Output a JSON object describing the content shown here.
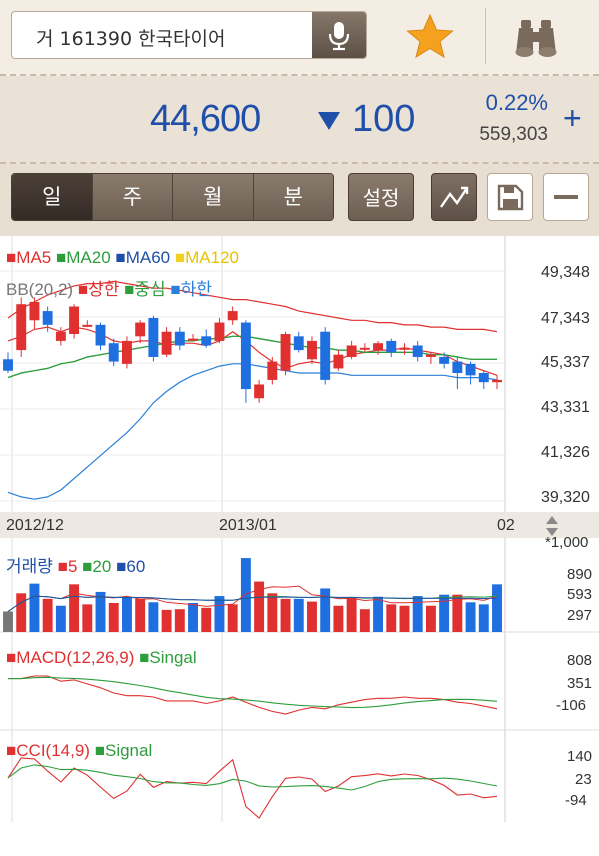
{
  "search": {
    "text": "거 161390 한국타이어"
  },
  "icons": {
    "mic": "microphone-icon",
    "favorite": "star-icon",
    "explore": "binoculars-icon",
    "colors": {
      "star": "#f4a11f",
      "up": "#e03030",
      "down": "#1f4fa8"
    }
  },
  "quote": {
    "price": "44,600",
    "change": "100",
    "rate": "0.22%",
    "volume": "559,303",
    "plus": "+"
  },
  "toolbar": {
    "periods": [
      "일",
      "주",
      "월",
      "분"
    ],
    "active_index": 0,
    "settings": "설정"
  },
  "price_chart": {
    "legend_ma": [
      {
        "label": "MA5",
        "color": "#e03030"
      },
      {
        "label": "MA20",
        "color": "#2e9e3c"
      },
      {
        "label": "MA60",
        "color": "#1f4fa8"
      },
      {
        "label": "MA120",
        "color": "#f0d020"
      }
    ],
    "legend_bb": {
      "title": "BB(20,2)",
      "items": [
        {
          "label": "상한",
          "color": "#e03030"
        },
        {
          "label": "중심",
          "color": "#2e9e3c"
        },
        {
          "label": "하한",
          "color": "#2a7fd8"
        }
      ]
    },
    "y_labels": [
      "49,348",
      "47,343",
      "45,337",
      "43,331",
      "41,326",
      "39,320"
    ]
  },
  "date_axis": {
    "labels": [
      "2012/12",
      "2013/01",
      "02"
    ]
  },
  "volume_chart": {
    "legend": {
      "title": "거래량",
      "items": [
        {
          "label": "5",
          "color": "#e03030"
        },
        {
          "label": "20",
          "color": "#2e9e3c"
        },
        {
          "label": "60",
          "color": "#1f4fa8"
        }
      ]
    },
    "unit": "*1,000",
    "y_labels": [
      "890",
      "593",
      "297"
    ]
  },
  "macd_chart": {
    "legend": [
      {
        "label": "MACD(12,26,9)",
        "color": "#e03030"
      },
      {
        "label": "Singal",
        "color": "#2e9e3c"
      }
    ],
    "y_labels": [
      "808",
      "351",
      "-106"
    ]
  },
  "cci_chart": {
    "legend": [
      {
        "label": "CCI(14,9)",
        "color": "#e03030"
      },
      {
        "label": "Signal",
        "color": "#2e9e3c"
      }
    ],
    "y_labels": [
      "140",
      "23",
      "-94"
    ]
  },
  "chart_data": {
    "type": "candlestick",
    "title": "",
    "x": [
      "2012/12",
      "2013/01",
      "02"
    ],
    "ylim": [
      39320,
      49348
    ],
    "candles": [
      {
        "o": 45500,
        "c": 45000,
        "h": 45800,
        "l": 44900
      },
      {
        "o": 45900,
        "c": 47900,
        "h": 48200,
        "l": 45600
      },
      {
        "o": 47200,
        "c": 48000,
        "h": 48200,
        "l": 46800
      },
      {
        "o": 47600,
        "c": 47000,
        "h": 47800,
        "l": 46700
      },
      {
        "o": 46300,
        "c": 46700,
        "h": 46900,
        "l": 46100
      },
      {
        "o": 46600,
        "c": 47800,
        "h": 47900,
        "l": 46400
      },
      {
        "o": 47000,
        "c": 47000,
        "h": 47200,
        "l": 46900
      },
      {
        "o": 47000,
        "c": 46100,
        "h": 47100,
        "l": 45900
      },
      {
        "o": 46200,
        "c": 45400,
        "h": 46400,
        "l": 45200
      },
      {
        "o": 45300,
        "c": 46300,
        "h": 46500,
        "l": 45100
      },
      {
        "o": 46500,
        "c": 47100,
        "h": 47200,
        "l": 46200
      },
      {
        "o": 47300,
        "c": 45600,
        "h": 47400,
        "l": 45400
      },
      {
        "o": 45700,
        "c": 46700,
        "h": 46900,
        "l": 45600
      },
      {
        "o": 46700,
        "c": 46100,
        "h": 46900,
        "l": 45900
      },
      {
        "o": 46400,
        "c": 46400,
        "h": 46600,
        "l": 46300
      },
      {
        "o": 46500,
        "c": 46100,
        "h": 46800,
        "l": 46000
      },
      {
        "o": 46300,
        "c": 47100,
        "h": 47300,
        "l": 46200
      },
      {
        "o": 47200,
        "c": 47600,
        "h": 47800,
        "l": 47000
      },
      {
        "o": 47100,
        "c": 44200,
        "h": 47200,
        "l": 43600
      },
      {
        "o": 43800,
        "c": 44400,
        "h": 44600,
        "l": 43600
      },
      {
        "o": 44600,
        "c": 45400,
        "h": 45600,
        "l": 44400
      },
      {
        "o": 45000,
        "c": 46600,
        "h": 46700,
        "l": 44800
      },
      {
        "o": 46500,
        "c": 45900,
        "h": 46700,
        "l": 45800
      },
      {
        "o": 45500,
        "c": 46300,
        "h": 46500,
        "l": 45300
      },
      {
        "o": 46700,
        "c": 44600,
        "h": 46900,
        "l": 44400
      },
      {
        "o": 45100,
        "c": 45700,
        "h": 45900,
        "l": 45000
      },
      {
        "o": 45600,
        "c": 46100,
        "h": 46300,
        "l": 45500
      },
      {
        "o": 46000,
        "c": 46000,
        "h": 46200,
        "l": 45800
      },
      {
        "o": 45900,
        "c": 46200,
        "h": 46300,
        "l": 45700
      },
      {
        "o": 46300,
        "c": 45800,
        "h": 46400,
        "l": 45600
      },
      {
        "o": 46000,
        "c": 46000,
        "h": 46200,
        "l": 45700
      },
      {
        "o": 46100,
        "c": 45600,
        "h": 46300,
        "l": 45400
      },
      {
        "o": 45600,
        "c": 45700,
        "h": 45800,
        "l": 45300
      },
      {
        "o": 45600,
        "c": 45300,
        "h": 45800,
        "l": 45100
      },
      {
        "o": 45400,
        "c": 44900,
        "h": 45600,
        "l": 44200
      },
      {
        "o": 45300,
        "c": 44800,
        "h": 45400,
        "l": 44400
      },
      {
        "o": 44900,
        "c": 44500,
        "h": 45000,
        "l": 44200
      },
      {
        "o": 44500,
        "c": 44600,
        "h": 44800,
        "l": 44200
      }
    ],
    "series": [
      {
        "name": "MA5",
        "values": [
          46300,
          46500,
          46800,
          46900,
          46700,
          46900,
          46800,
          46600,
          46300,
          46200,
          46300,
          46300,
          46100,
          46200,
          46200,
          46100,
          46300,
          46700,
          46300,
          45800,
          45400,
          45100,
          45300,
          45400,
          45300,
          45500,
          45700,
          45800,
          45900,
          45900,
          46000,
          45900,
          45800,
          45700,
          45400,
          45200,
          45000,
          44800
        ]
      },
      {
        "name": "MA20",
        "values": [
          44700,
          44900,
          45000,
          45100,
          45300,
          45400,
          45600,
          45700,
          45800,
          45900,
          46000,
          46100,
          46200,
          46300,
          46300,
          46400,
          46400,
          46500,
          46500,
          46400,
          46300,
          46200,
          46100,
          46000,
          46000,
          45900,
          45900,
          45800,
          45800,
          45800,
          45800,
          45800,
          45700,
          45700,
          45600,
          45500,
          45500,
          45500
        ]
      },
      {
        "name": "BB upper",
        "values": [
          47300,
          47700,
          48000,
          48300,
          48500,
          48700,
          48800,
          48800,
          48900,
          48800,
          48700,
          48600,
          48600,
          48500,
          48400,
          48300,
          48200,
          48100,
          48100,
          48000,
          47900,
          47800,
          47600,
          47500,
          47400,
          47300,
          47200,
          47200,
          47100,
          47100,
          47000,
          47000,
          46900,
          46900,
          46800,
          46800,
          46800,
          46700
        ]
      },
      {
        "name": "BB middle",
        "values": [
          44700,
          44900,
          45000,
          45100,
          45300,
          45400,
          45600,
          45700,
          45800,
          45900,
          46000,
          46100,
          46200,
          46300,
          46300,
          46400,
          46400,
          46500,
          46500,
          46400,
          46300,
          46200,
          46100,
          46000,
          46000,
          45900,
          45900,
          45800,
          45800,
          45800,
          45800,
          45800,
          45700,
          45700,
          45600,
          45500,
          45500,
          45500
        ]
      },
      {
        "name": "BB lower",
        "values": [
          39700,
          39500,
          39400,
          39500,
          39800,
          40300,
          40800,
          41300,
          41800,
          42300,
          42900,
          43600,
          44100,
          44500,
          44800,
          45000,
          45200,
          45300,
          45300,
          45200,
          45100,
          45000,
          44900,
          44900,
          44900,
          44900,
          44800,
          44800,
          44800,
          44800,
          44800,
          44800,
          44800,
          44800,
          44700,
          44700,
          44700,
          44600
        ]
      }
    ],
    "volume": [
      {
        "v": 297,
        "dir": "flat"
      },
      {
        "v": 560,
        "dir": "up"
      },
      {
        "v": 700,
        "dir": "down"
      },
      {
        "v": 480,
        "dir": "up"
      },
      {
        "v": 380,
        "dir": "down"
      },
      {
        "v": 690,
        "dir": "up"
      },
      {
        "v": 400,
        "dir": "up"
      },
      {
        "v": 580,
        "dir": "down"
      },
      {
        "v": 420,
        "dir": "up"
      },
      {
        "v": 500,
        "dir": "down"
      },
      {
        "v": 480,
        "dir": "up"
      },
      {
        "v": 430,
        "dir": "down"
      },
      {
        "v": 320,
        "dir": "up"
      },
      {
        "v": 330,
        "dir": "up"
      },
      {
        "v": 420,
        "dir": "down"
      },
      {
        "v": 350,
        "dir": "up"
      },
      {
        "v": 520,
        "dir": "down"
      },
      {
        "v": 400,
        "dir": "up"
      },
      {
        "v": 1070,
        "dir": "down"
      },
      {
        "v": 730,
        "dir": "up"
      },
      {
        "v": 560,
        "dir": "up"
      },
      {
        "v": 480,
        "dir": "up"
      },
      {
        "v": 480,
        "dir": "down"
      },
      {
        "v": 440,
        "dir": "up"
      },
      {
        "v": 630,
        "dir": "down"
      },
      {
        "v": 380,
        "dir": "up"
      },
      {
        "v": 500,
        "dir": "up"
      },
      {
        "v": 330,
        "dir": "up"
      },
      {
        "v": 510,
        "dir": "down"
      },
      {
        "v": 400,
        "dir": "up"
      },
      {
        "v": 380,
        "dir": "up"
      },
      {
        "v": 520,
        "dir": "down"
      },
      {
        "v": 380,
        "dir": "up"
      },
      {
        "v": 540,
        "dir": "down"
      },
      {
        "v": 540,
        "dir": "up"
      },
      {
        "v": 430,
        "dir": "down"
      },
      {
        "v": 400,
        "dir": "down"
      },
      {
        "v": 690,
        "dir": "down"
      }
    ]
  }
}
